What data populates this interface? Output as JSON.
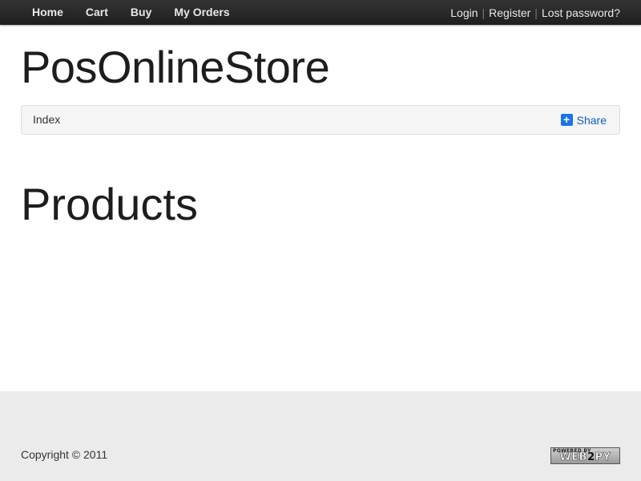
{
  "nav": {
    "items": [
      {
        "label": "Home"
      },
      {
        "label": "Cart"
      },
      {
        "label": "Buy"
      },
      {
        "label": "My Orders"
      }
    ]
  },
  "auth": {
    "login": "Login",
    "register": "Register",
    "lost_password": "Lost password?",
    "separator": "|"
  },
  "header": {
    "title": "PosOnlineStore"
  },
  "breadcrumb": {
    "current": "Index",
    "share_label": "Share",
    "share_icon": "plus-square-icon"
  },
  "main": {
    "heading": "Products"
  },
  "footer": {
    "copyright": "Copyright © 2011",
    "powered_by": "POWERED BY",
    "powered_brand_a": "WEB",
    "powered_brand_b": "2",
    "powered_brand_c": "PY"
  },
  "colors": {
    "topbar": "#222222",
    "share": "#1a73e8",
    "footer": "#ebebeb"
  }
}
